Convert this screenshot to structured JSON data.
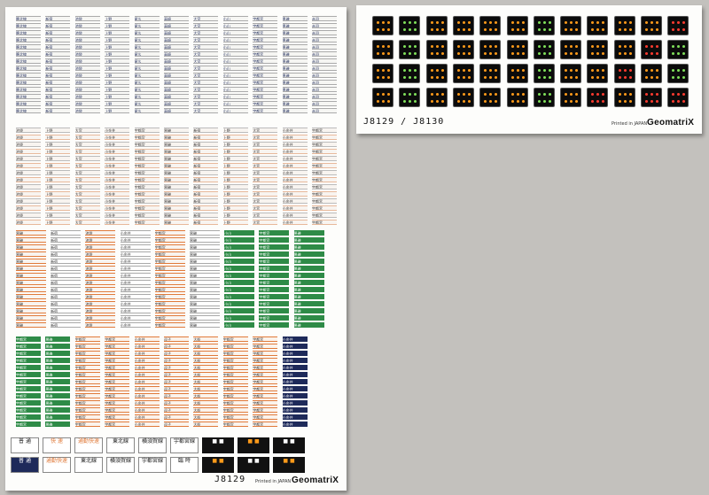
{
  "left_sheet": {
    "code": "J8129",
    "printed_note": "Printed in JAPAN",
    "brand": "GeomatriX",
    "top_columns": [
      "籠北線",
      "新宿",
      "池袋",
      "上野",
      "尾久",
      "高崎",
      "大宮",
      "小山",
      "宇都宮",
      "黒磯",
      "赤羽"
    ],
    "mid_columns": [
      "池袋",
      "上野",
      "大宮",
      "小金井",
      "宇都宮",
      "黒磯",
      "新宿",
      "上野",
      "大宮",
      "小金井",
      "宇都宮"
    ],
    "green_columns": [
      "黒磯",
      "新宿",
      "池袋",
      "小金井",
      "宇都宮",
      "黒磯",
      "小山",
      "宇都宮",
      "黒磯"
    ],
    "bottom_columns": [
      "宇都宮",
      "黒磯",
      "宇都宮",
      "宇都宮",
      "小金井",
      "逗子",
      "大船",
      "宇都宮",
      "宇都宮",
      "小金井"
    ],
    "misc_labels": [
      "普 通",
      "快 速",
      "通勤快速",
      "東北線",
      "横須賀線",
      "宇都宮線",
      "普 通",
      "通勤快速",
      "東北線",
      "横須賀線",
      "宇都宮線",
      "臨 時"
    ]
  },
  "right_sheet": {
    "code": "J8129 / J8130",
    "printed_note": "Printed in JAPAN",
    "brand": "GeomatriX"
  },
  "colors": {
    "background": "#c3c1bd",
    "sheet": "#fdfdfb",
    "navy": "#1e2a5a",
    "green": "#2e8b47",
    "orange": "#e07a3a",
    "led_orange": "#ff9a1a",
    "led_green": "#7fe05a",
    "led_red": "#ff3b30"
  }
}
